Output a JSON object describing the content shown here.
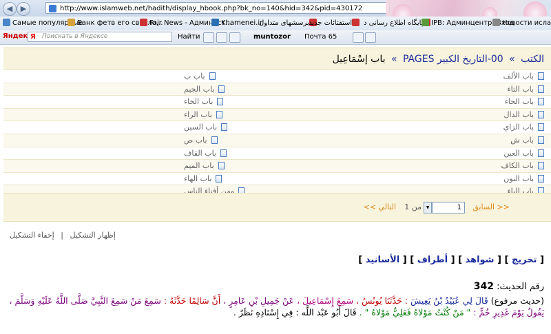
{
  "browser": {
    "url": "http://www.islamweb.net/hadith/display_hbook.php?bk_no=140&hid=342&pid=430172",
    "bookmarks": [
      "Самые популярные",
      "Банк фетв его светло...",
      "Fajr News - Админист...",
      "Khamenei.ir",
      "برسشهاى متداول",
      "استفتائات جديد",
      "پايگاه اطلاع رسانى د",
      "IPB: Админцентр: Вход",
      "Новости исламског"
    ],
    "yandex": {
      "logo": "Яндекс",
      "search_placeholder": "Поискать в Яндексе",
      "find": "Найти",
      "user": "muntozor",
      "mail": "Почта 65"
    }
  },
  "breadcrumb": {
    "home": "الكتب",
    "book": "00-التاريخ الكبير PAGES",
    "current": "باب إسْمَاعِيل",
    "sep": "»"
  },
  "chapters": [
    {
      "right": "باب الألف",
      "left": "باب ب"
    },
    {
      "right": "باب التاء",
      "left": "باب الجيم"
    },
    {
      "right": "باب الحاء",
      "left": "باب الخاء"
    },
    {
      "right": "باب الدال",
      "left": "باب الراء"
    },
    {
      "right": "باب الزاي",
      "left": "باب السين"
    },
    {
      "right": "باب ش",
      "left": "باب ص"
    },
    {
      "right": "باب العين",
      "left": "باب القاف"
    },
    {
      "right": "باب الكاف",
      "left": "باب الميم"
    },
    {
      "right": "باب النون",
      "left": "باب الهاء"
    },
    {
      "right": "باب الياء",
      "left": "ومن أفناء الناس"
    }
  ],
  "pager": {
    "prev": "<< السابق",
    "page_value": "1",
    "of": "من 1",
    "next": "التالي >>"
  },
  "tashkeel": {
    "show": "إظهار التشكيل",
    "hide": "إخفاء التشكيل",
    "sep": "|"
  },
  "hadith_links": [
    "تخريج",
    "شواهد",
    "أطراف",
    "الأسانيد"
  ],
  "hadith": {
    "number_label": "رقم الحديث:",
    "number": "342",
    "prefix": "(حديث مرفوع)",
    "seg1": "قَالَ لِي عُبَيْدُ بْنُ يَعِيشَ",
    "seg2": ": حَدَّثَنَا يُونُسُ ،",
    "seg3": "سَمِعَ إِسْمَاعِيلَ ،",
    "seg4": "عَنْ جَمِيلِ بْنِ عَامِرٍ ،",
    "seg5": "أَنَّ سَالِمًا حَدَّثَهُ :",
    "seg6": "سَمِعَ مَنْ سَمِعَ النَّبِيَّ صَلَّى اللَّهُ عَلَيْهِ وَسَلَّمَ ، يَقُولُ يَوْمَ غَدِيرِ خُمٍّ :",
    "quote": "\" مَنْ كُنْتُ مَوْلاهُ فَعَلِيٌّ مَوْلاهُ \" .",
    "tail": "قَالَ أَبُو عَبْد اللَّه : فِي إِسْنَادِهِ نَظَرٌ ."
  }
}
